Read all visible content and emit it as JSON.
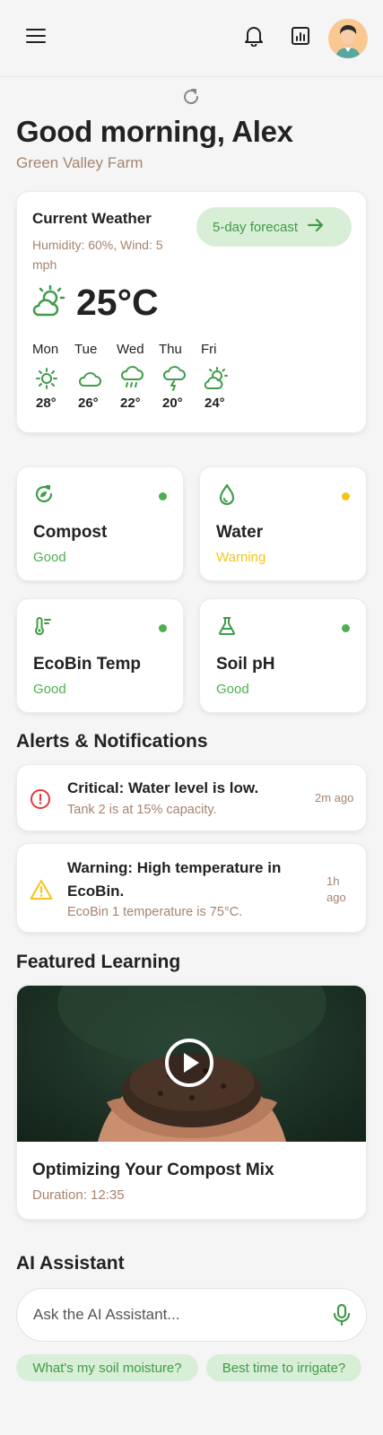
{
  "header": {
    "menu_icon": "menu-icon",
    "notifications_icon": "bell-icon",
    "reports_icon": "bar-chart-icon",
    "avatar": "user-avatar"
  },
  "greeting": "Good morning, Alex",
  "farm_name": "Green Valley Farm",
  "weather": {
    "title": "Current Weather",
    "subtitle": "Humidity: 60%, Wind: 5 mph",
    "forecast_button": "5-day forecast",
    "temperature": "25°C",
    "current_icon": "partly-sunny-icon",
    "days": [
      {
        "day": "Mon",
        "temp": "28°",
        "icon": "sun-icon"
      },
      {
        "day": "Tue",
        "temp": "26°",
        "icon": "cloud-icon"
      },
      {
        "day": "Wed",
        "temp": "22°",
        "icon": "rain-icon"
      },
      {
        "day": "Thu",
        "temp": "20°",
        "icon": "storm-icon"
      },
      {
        "day": "Fri",
        "temp": "24°",
        "icon": "partly-sunny-icon"
      }
    ]
  },
  "status_cards": [
    {
      "name": "Compost",
      "status": "Good",
      "icon": "compost-icon",
      "color": "#4caf50"
    },
    {
      "name": "Water",
      "status": "Warning",
      "icon": "water-drop-icon",
      "color": "#f5c518"
    },
    {
      "name": "EcoBin Temp",
      "status": "Good",
      "icon": "thermometer-icon",
      "color": "#4caf50"
    },
    {
      "name": "Soil pH",
      "status": "Good",
      "icon": "flask-icon",
      "color": "#4caf50"
    }
  ],
  "alerts": {
    "title": "Alerts & Notifications",
    "items": [
      {
        "title": "Critical: Water level is low.",
        "desc": "Tank 2 is at 15% capacity.",
        "time": "2m ago",
        "icon": "error-circle-icon",
        "color": "#e53935"
      },
      {
        "title": "Warning: High temperature in EcoBin.",
        "desc": "EcoBin 1 temperature is 75°C.",
        "time": "1h ago",
        "icon": "warning-triangle-icon",
        "color": "#f5c518"
      }
    ]
  },
  "learning": {
    "title": "Featured Learning",
    "video_title": "Optimizing Your Compost Mix",
    "duration": "Duration: 12:35",
    "play_icon": "play-icon"
  },
  "assistant": {
    "title": "AI Assistant",
    "placeholder": "Ask the AI Assistant...",
    "mic_icon": "microphone-icon",
    "suggestions": [
      "What's my soil moisture?",
      "Best time to irrigate?"
    ]
  },
  "colors": {
    "accent_green": "#3f9c48",
    "chip_bg": "#d8eed7",
    "muted_brown": "#a5846f",
    "warning_yellow": "#f5c518",
    "critical_red": "#e53935"
  }
}
